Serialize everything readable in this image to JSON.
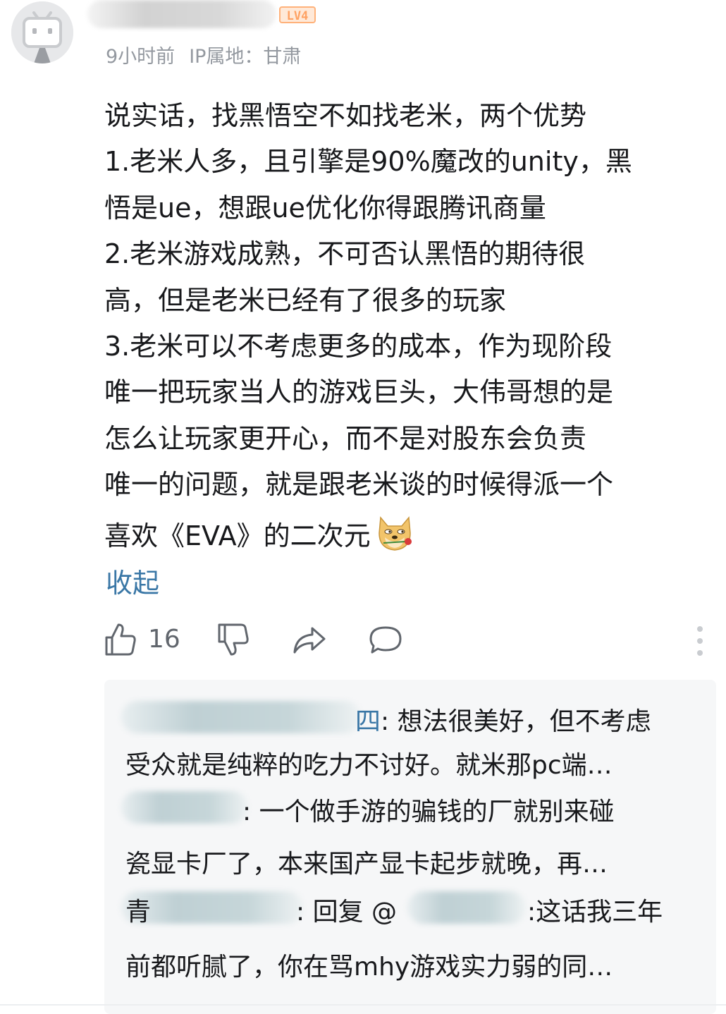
{
  "header": {
    "level": "LV4",
    "time": "9小时前",
    "ip_location": "IP属地：甘肃"
  },
  "comment": {
    "lines": [
      "说实话，找黑悟空不如找老米，两个优势",
      "1.老米人多，且引擎是90%魔改的unity，黑",
      "悟是ue，想跟ue优化你得跟腾讯商量",
      "2.老米游戏成熟，不可否认黑悟的期待很",
      "高，但是老米已经有了很多的玩家",
      "3.老米可以不考虑更多的成本，作为现阶段",
      "唯一把玩家当人的游戏巨头，大伟哥想的是",
      "怎么让玩家更开心，而不是对股东会负责",
      "唯一的问题，就是跟老米谈的时候得派一个",
      "喜欢《EVA》的二次元"
    ],
    "emoji": "doge-with-rose",
    "collapse_label": "收起"
  },
  "actions": {
    "like_count": "16",
    "icons": [
      "thumbs-up-icon",
      "thumbs-down-icon",
      "share-icon",
      "comment-icon",
      "more-icon"
    ]
  },
  "replies": {
    "items": [
      {
        "name_tail": "四",
        "lines": [
          ": 想法很美好，但不考虑",
          "受众就是纯粹的吃力不讨好。就米那pc端…"
        ]
      },
      {
        "name_tail": "",
        "lines": [
          ": 一个做手游的骗钱的厂就别来碰",
          "瓷显卡厂了，本来国产显卡起步就晚，再…"
        ]
      },
      {
        "name_tail": "青",
        "reply_prefix": ": 回复 @",
        "reply_suffix": " :这话我三年",
        "lines": [
          "前都听腻了，你在骂mhy游戏实力弱的同…"
        ]
      }
    ]
  },
  "colors": {
    "link": "#3a77a6",
    "text": "#18191c",
    "meta": "#9499a0",
    "reply_bg": "#f6f7f8",
    "level_badge": "#ffa263"
  }
}
